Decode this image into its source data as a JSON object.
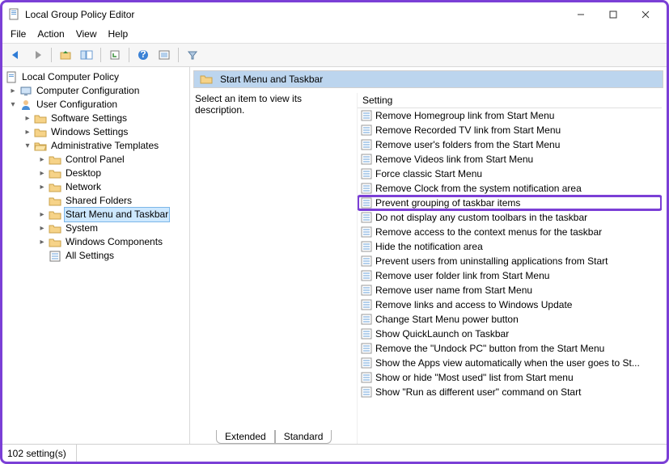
{
  "window": {
    "title": "Local Group Policy Editor"
  },
  "menubar": {
    "file": "File",
    "action": "Action",
    "view": "View",
    "help": "Help"
  },
  "tree": {
    "root": "Local Computer Policy",
    "computer_cfg": "Computer Configuration",
    "user_cfg": "User Configuration",
    "software_settings": "Software Settings",
    "windows_settings": "Windows Settings",
    "admin_templates": "Administrative Templates",
    "control_panel": "Control Panel",
    "desktop": "Desktop",
    "network": "Network",
    "shared_folders": "Shared Folders",
    "start_menu_taskbar": "Start Menu and Taskbar",
    "system": "System",
    "windows_components": "Windows Components",
    "all_settings": "All Settings"
  },
  "content": {
    "title": "Start Menu and Taskbar",
    "description": "Select an item to view its description.",
    "col_setting": "Setting",
    "items": [
      "Remove Homegroup link from Start Menu",
      "Remove Recorded TV link from Start Menu",
      "Remove user's folders from the Start Menu",
      "Remove Videos link from Start Menu",
      "Force classic Start Menu",
      "Remove Clock from the system notification area",
      "Prevent grouping of taskbar items",
      "Do not display any custom toolbars in the taskbar",
      "Remove access to the context menus for the taskbar",
      "Hide the notification area",
      "Prevent users from uninstalling applications from Start",
      "Remove user folder link from Start Menu",
      "Remove user name from Start Menu",
      "Remove links and access to Windows Update",
      "Change Start Menu power button",
      "Show QuickLaunch on Taskbar",
      "Remove the \"Undock PC\" button from the Start Menu",
      "Show the Apps view automatically when the user goes to St...",
      "Show or hide \"Most used\" list from Start menu",
      "Show \"Run as different user\" command on Start"
    ],
    "highlight_index": 6
  },
  "tabs": {
    "extended": "Extended",
    "standard": "Standard"
  },
  "statusbar": {
    "count": "102 setting(s)"
  }
}
